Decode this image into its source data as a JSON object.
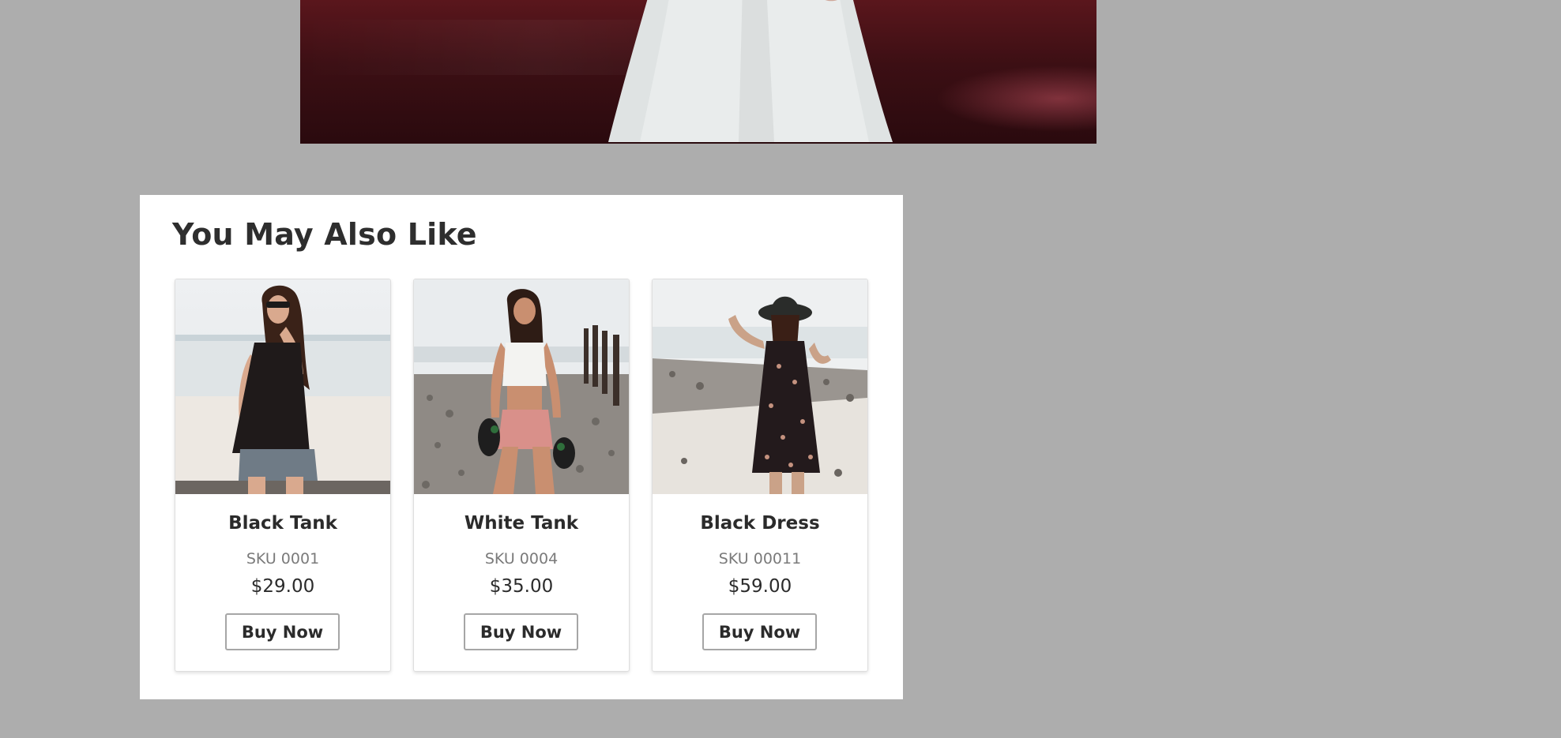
{
  "related": {
    "title": "You May Also Like",
    "buy_label": "Buy Now",
    "products": [
      {
        "name": "Black Tank",
        "sku": "SKU 0001",
        "price": "$29.00"
      },
      {
        "name": "White Tank",
        "sku": "SKU 0004",
        "price": "$35.00"
      },
      {
        "name": "Black Dress",
        "sku": "SKU 00011",
        "price": "$59.00"
      }
    ]
  },
  "colors": {
    "page_background": "#adadad",
    "panel_background": "#ffffff",
    "heading_text": "#2e2e2e",
    "sku_text": "#7a7a7a",
    "hero_background": "#3c0f14"
  }
}
